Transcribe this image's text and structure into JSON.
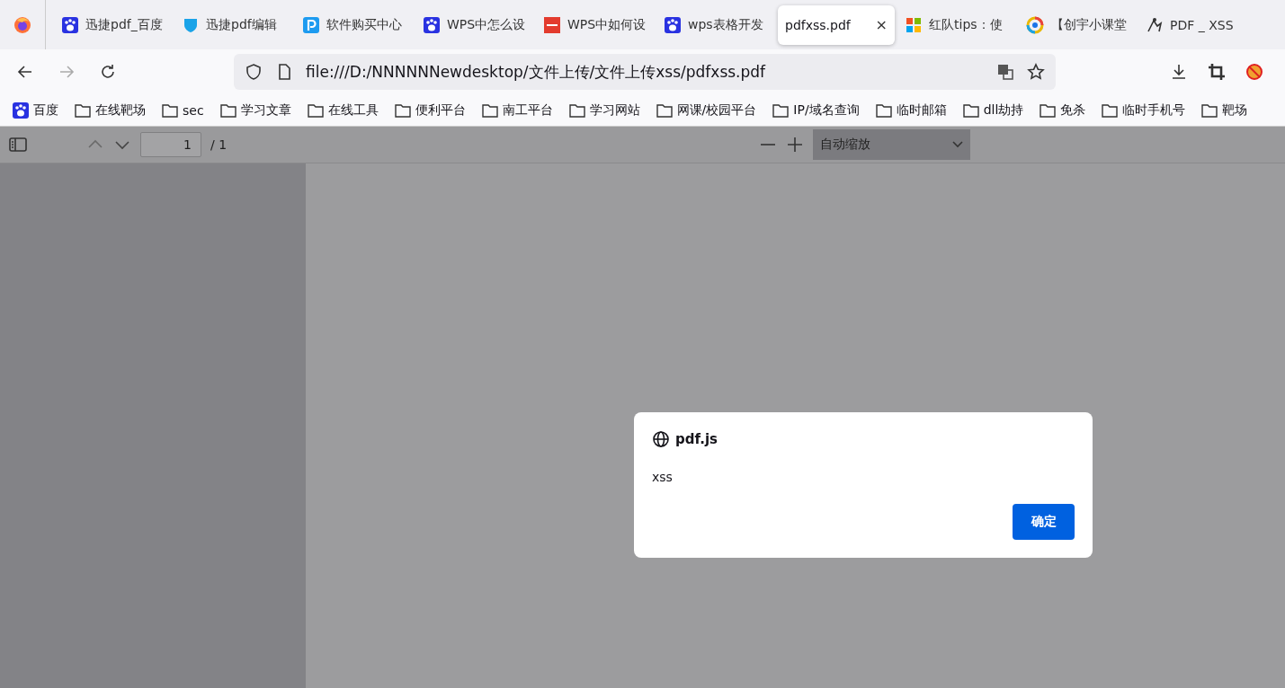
{
  "tabs": [
    {
      "title": "迅捷pdf_百度",
      "kind": "paw",
      "selected": false
    },
    {
      "title": "迅捷pdf编辑",
      "kind": "shield",
      "selected": false
    },
    {
      "title": "软件购买中心",
      "kind": "letter",
      "selected": false
    },
    {
      "title": "WPS中怎么设",
      "kind": "paw",
      "selected": false
    },
    {
      "title": "WPS中如何设",
      "kind": "wps",
      "selected": false
    },
    {
      "title": "wps表格开发",
      "kind": "paw",
      "selected": false
    },
    {
      "title": "pdfxss.pdf",
      "kind": "none",
      "selected": true,
      "close": "×"
    },
    {
      "title": "红队tips：使",
      "kind": "squares",
      "selected": false
    },
    {
      "title": "【创宇小课堂",
      "kind": "ring",
      "selected": false
    },
    {
      "title": "PDF _ XSS",
      "kind": "figure",
      "selected": false
    }
  ],
  "address": {
    "url": "file:///D:/NNNNNNewdesktop/文件上传/文件上传xss/pdfxss.pdf"
  },
  "bookmarks": [
    {
      "label": "百度",
      "kind": "paw"
    },
    {
      "label": "在线靶场",
      "kind": "folder"
    },
    {
      "label": "sec",
      "kind": "folder"
    },
    {
      "label": "学习文章",
      "kind": "folder"
    },
    {
      "label": "在线工具",
      "kind": "folder"
    },
    {
      "label": "便利平台",
      "kind": "folder"
    },
    {
      "label": "南工平台",
      "kind": "folder"
    },
    {
      "label": "学习网站",
      "kind": "folder"
    },
    {
      "label": "网课/校园平台",
      "kind": "folder"
    },
    {
      "label": "IP/域名查询",
      "kind": "folder"
    },
    {
      "label": "临时邮箱",
      "kind": "folder"
    },
    {
      "label": "dll劫持",
      "kind": "folder"
    },
    {
      "label": "免杀",
      "kind": "folder"
    },
    {
      "label": "临时手机号",
      "kind": "folder"
    },
    {
      "label": "靶场",
      "kind": "folder"
    }
  ],
  "pdf_toolbar": {
    "page": "1",
    "page_count": "/ 1",
    "zoom": "自动缩放"
  },
  "dialog": {
    "origin": "pdf.js",
    "message": "xss",
    "button": "确定"
  }
}
